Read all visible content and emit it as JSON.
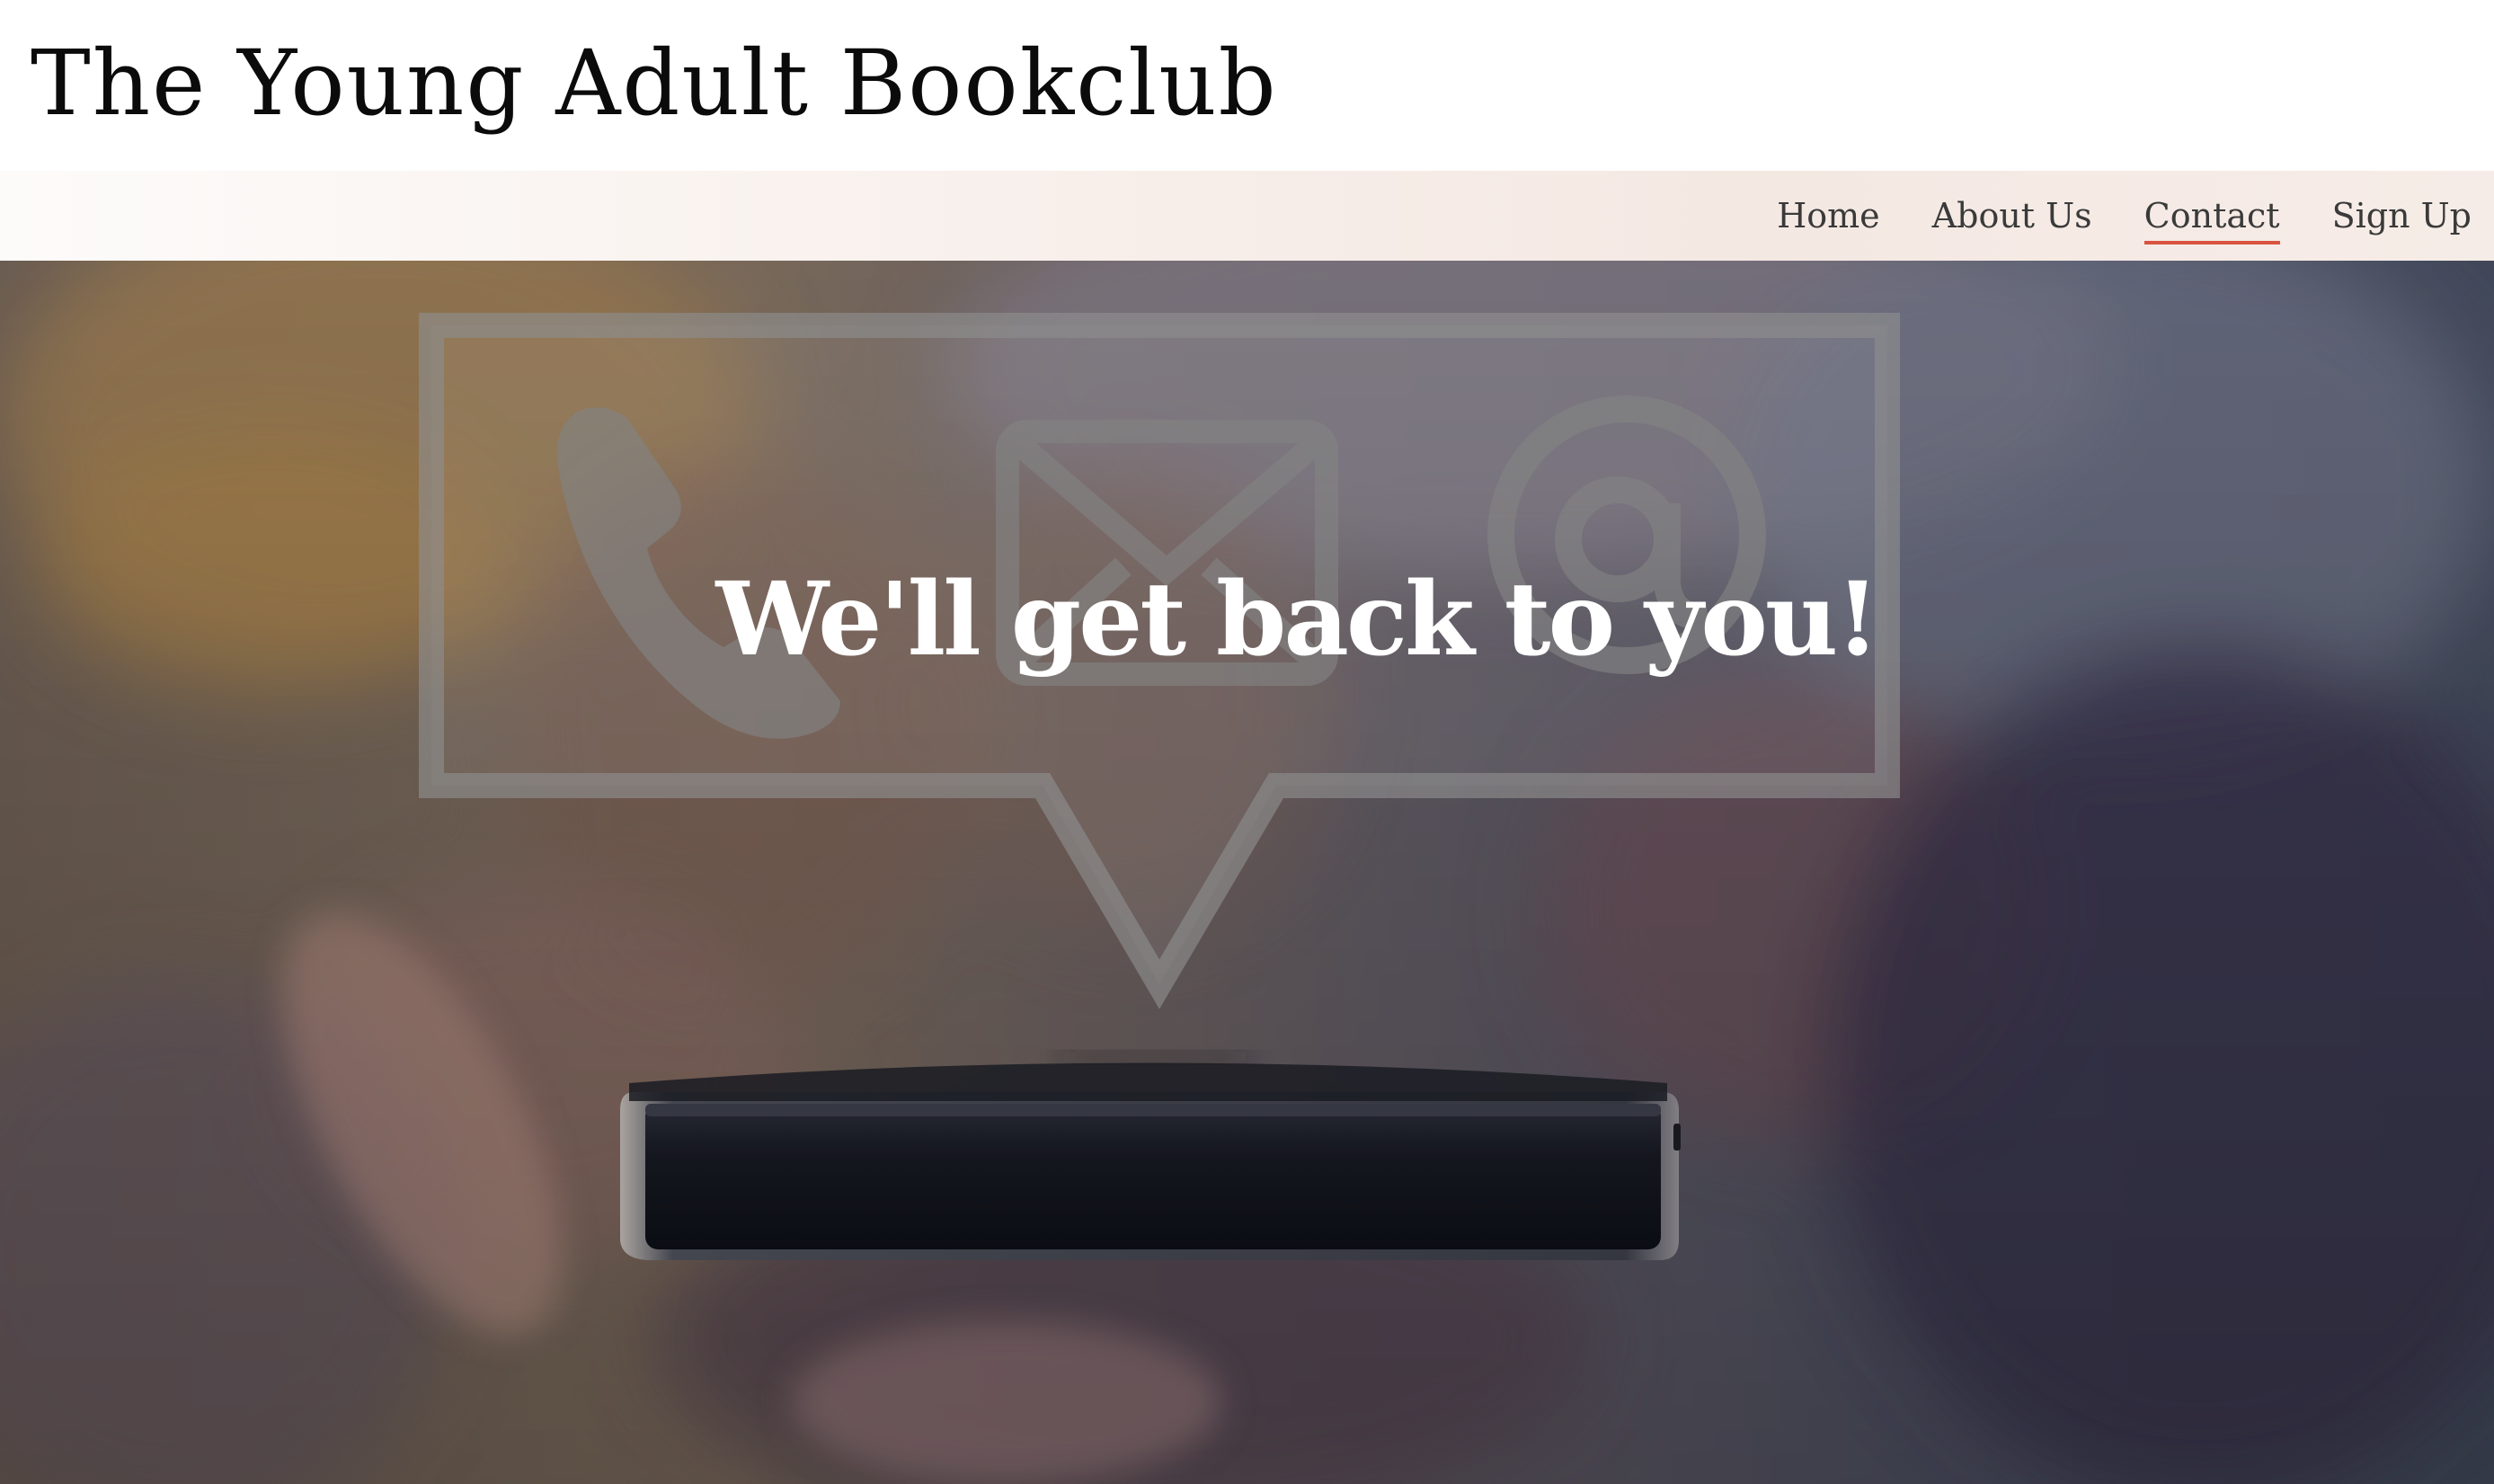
{
  "site": {
    "title": "The Young Adult Bookclub"
  },
  "nav": {
    "items": [
      {
        "label": "Home",
        "active": false
      },
      {
        "label": "About Us",
        "active": false
      },
      {
        "label": "Contact",
        "active": true
      },
      {
        "label": "Sign Up",
        "active": false
      }
    ]
  },
  "hero": {
    "heading": "We'll get back to you!",
    "illustration_icons": [
      "phone-icon",
      "envelope-icon",
      "at-sign-icon"
    ]
  },
  "colors": {
    "active_underline": "#d9533f",
    "nav_text": "#3a3a3a",
    "hero_text": "#ffffff"
  }
}
